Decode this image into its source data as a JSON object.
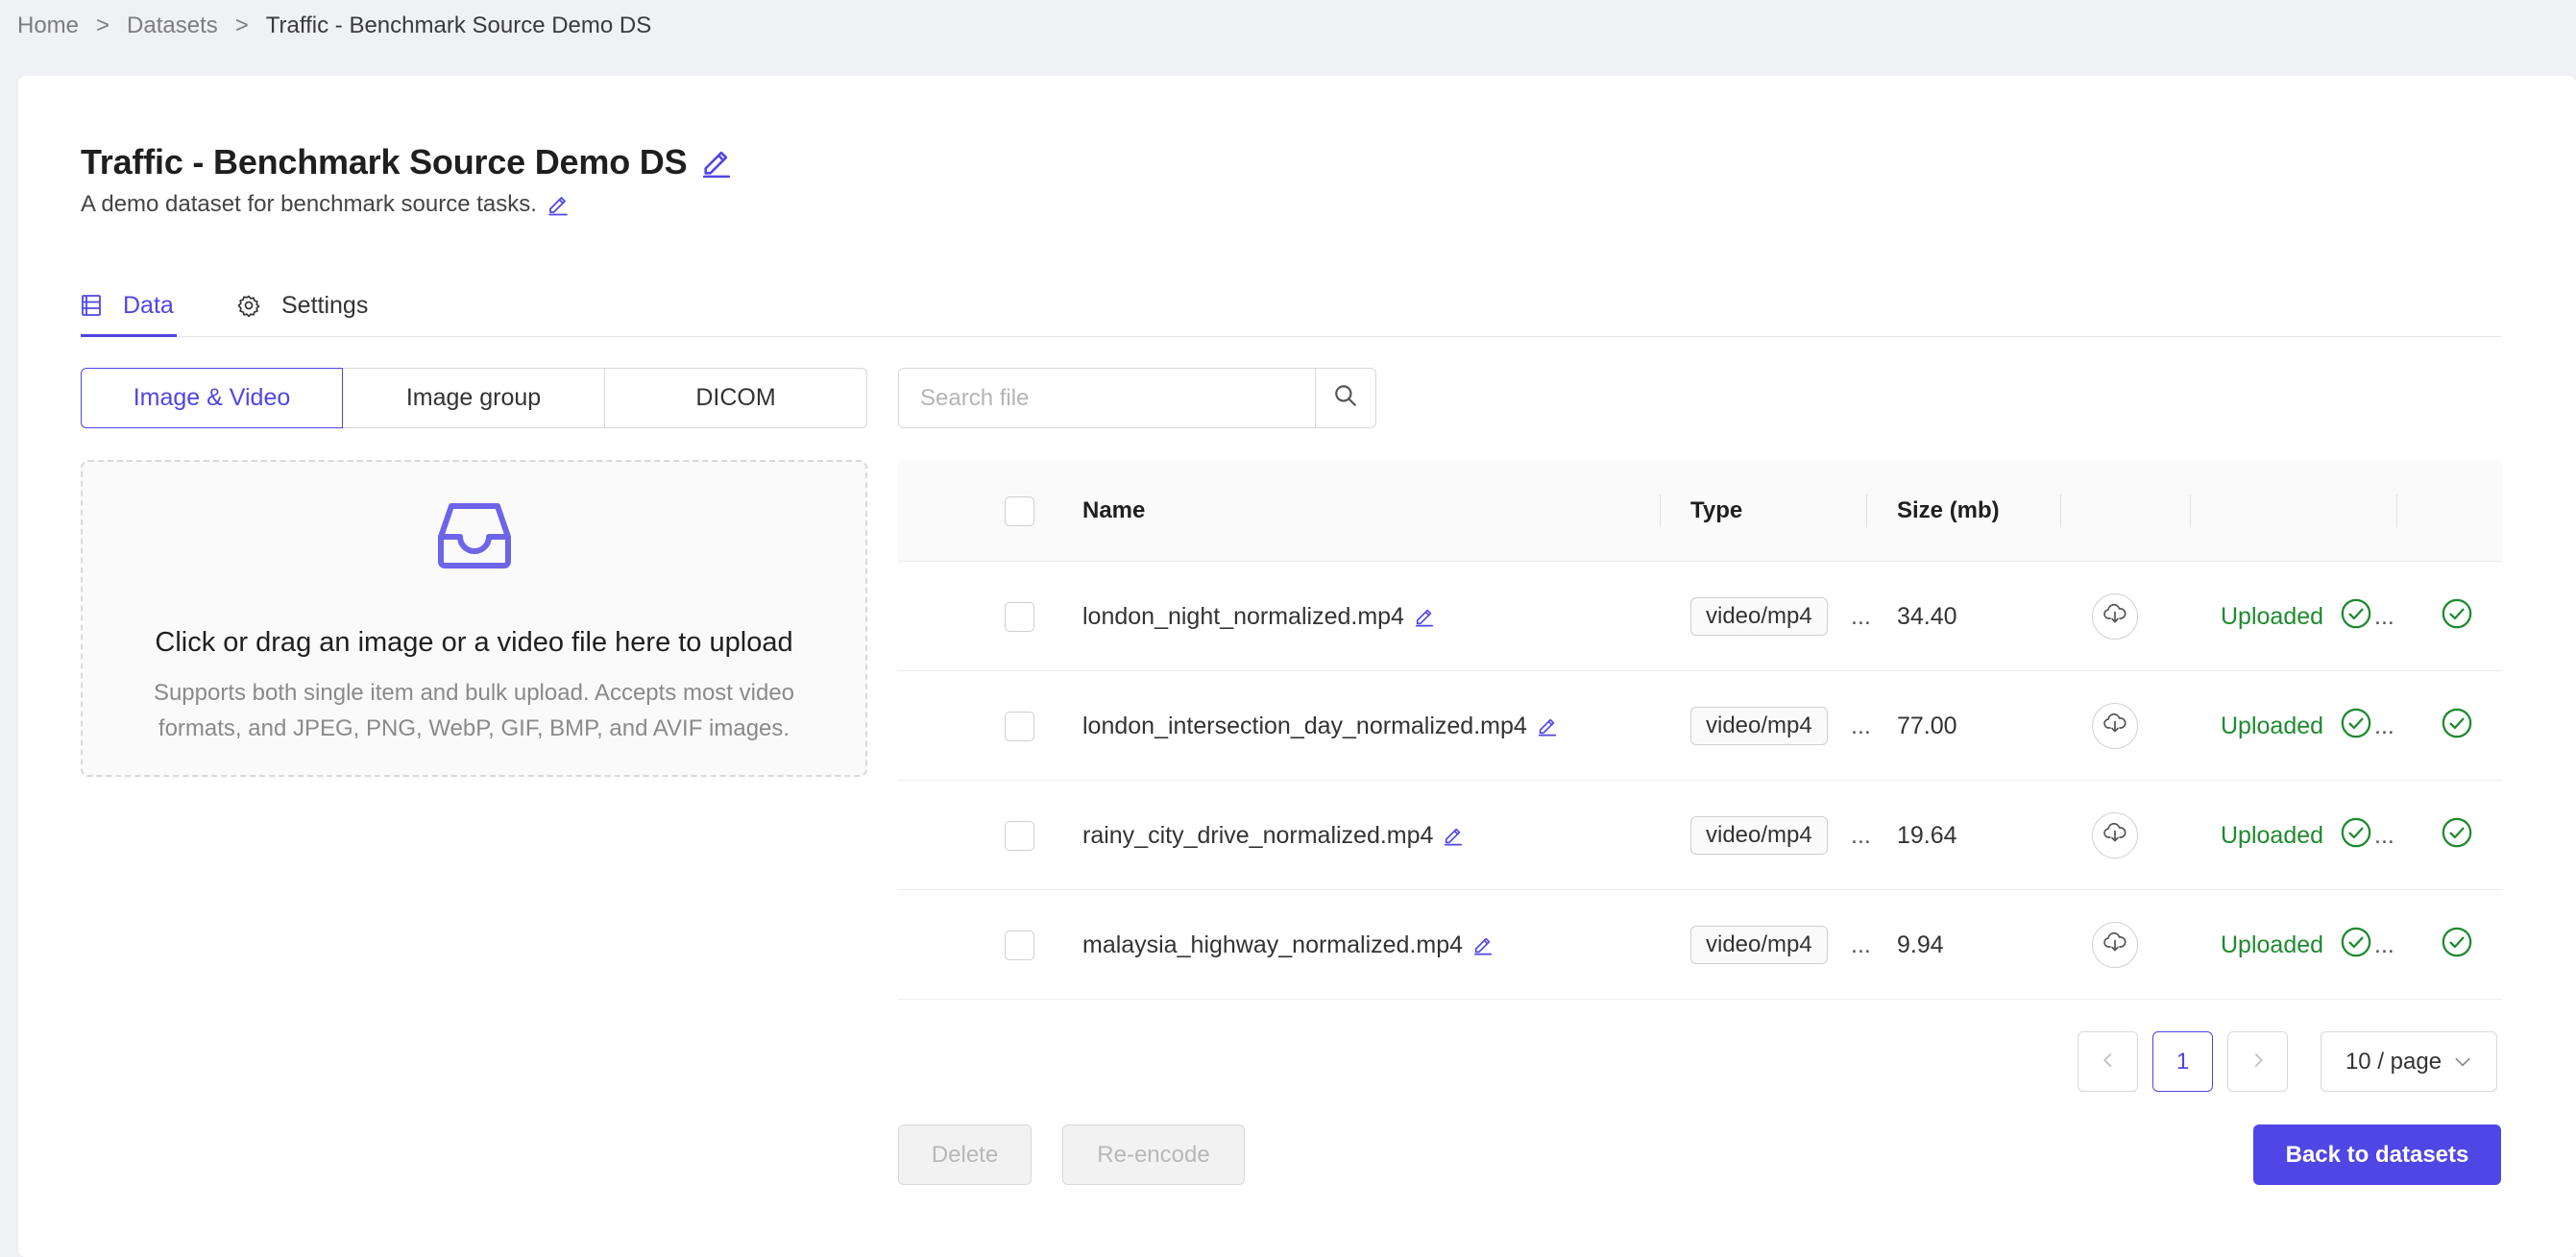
{
  "breadcrumb": {
    "items": [
      "Home",
      "Datasets",
      "Traffic - Benchmark Source Demo DS"
    ],
    "separator": ">"
  },
  "dataset": {
    "title": "Traffic - Benchmark Source Demo DS",
    "description": "A demo dataset for benchmark source tasks."
  },
  "tabs": [
    {
      "label": "Data",
      "icon": "database-icon",
      "active": true
    },
    {
      "label": "Settings",
      "icon": "gear-icon",
      "active": false
    }
  ],
  "upload_types": [
    {
      "label": "Image & Video",
      "active": true
    },
    {
      "label": "Image group",
      "active": false
    },
    {
      "label": "DICOM",
      "active": false
    }
  ],
  "dropzone": {
    "icon": "inbox-icon",
    "title": "Click or drag an image or a video file here to upload",
    "hint": "Supports both single item and bulk upload. Accepts most video formats, and JPEG, PNG, WebP, GIF, BMP, and AVIF images."
  },
  "search": {
    "placeholder": "Search file",
    "value": ""
  },
  "table": {
    "columns": [
      "Name",
      "Type",
      "Size (mb)"
    ],
    "rows": [
      {
        "name": "london_night_normalized.mp4",
        "type": "video/mp4",
        "size": "34.40",
        "status": "Uploaded"
      },
      {
        "name": "london_intersection_day_normalized.mp4",
        "type": "video/mp4",
        "size": "77.00",
        "status": "Uploaded"
      },
      {
        "name": "rainy_city_drive_normalized.mp4",
        "type": "video/mp4",
        "size": "19.64",
        "status": "Uploaded"
      },
      {
        "name": "malaysia_highway_normalized.mp4",
        "type": "video/mp4",
        "size": "9.94",
        "status": "Uploaded"
      }
    ],
    "ellipsis": "..."
  },
  "pagination": {
    "current_page": "1",
    "page_size": "10 / page"
  },
  "actions": {
    "delete": "Delete",
    "reencode": "Re-encode",
    "back": "Back to datasets"
  },
  "colors": {
    "accent": "#4f46e5",
    "success": "#1e8a2e"
  }
}
